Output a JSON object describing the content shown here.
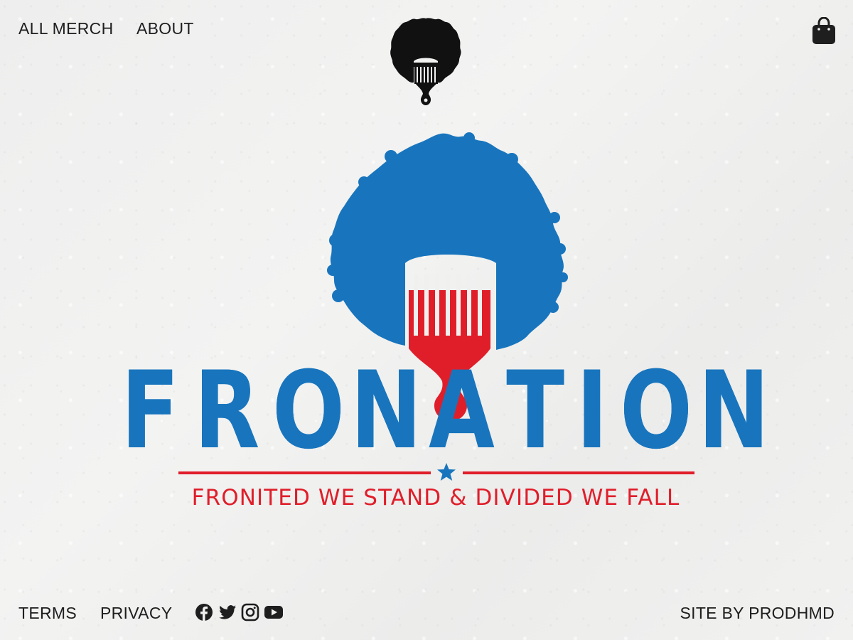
{
  "nav": {
    "all_merch": "ALL MERCH",
    "about": "ABOUT"
  },
  "header": {
    "logo_icon": "afro-pick-logo-icon",
    "cart_icon": "shopping-bag-icon"
  },
  "hero": {
    "brand_letters": [
      "F",
      "R",
      "O",
      "N",
      "",
      "T",
      "I",
      "O",
      "N"
    ],
    "logo_lettering": "FRONATION",
    "tagline": "FRONITED WE STAND & DIVIDED WE FALL",
    "colors": {
      "blue": "#1875bd",
      "red": "#e01e2a",
      "black": "#111111"
    }
  },
  "footer": {
    "terms": "TERMS",
    "privacy": "PRIVACY",
    "credit": "SITE BY PRODHMD",
    "social_icons": [
      "facebook-icon",
      "twitter-icon",
      "instagram-icon",
      "youtube-icon"
    ]
  }
}
